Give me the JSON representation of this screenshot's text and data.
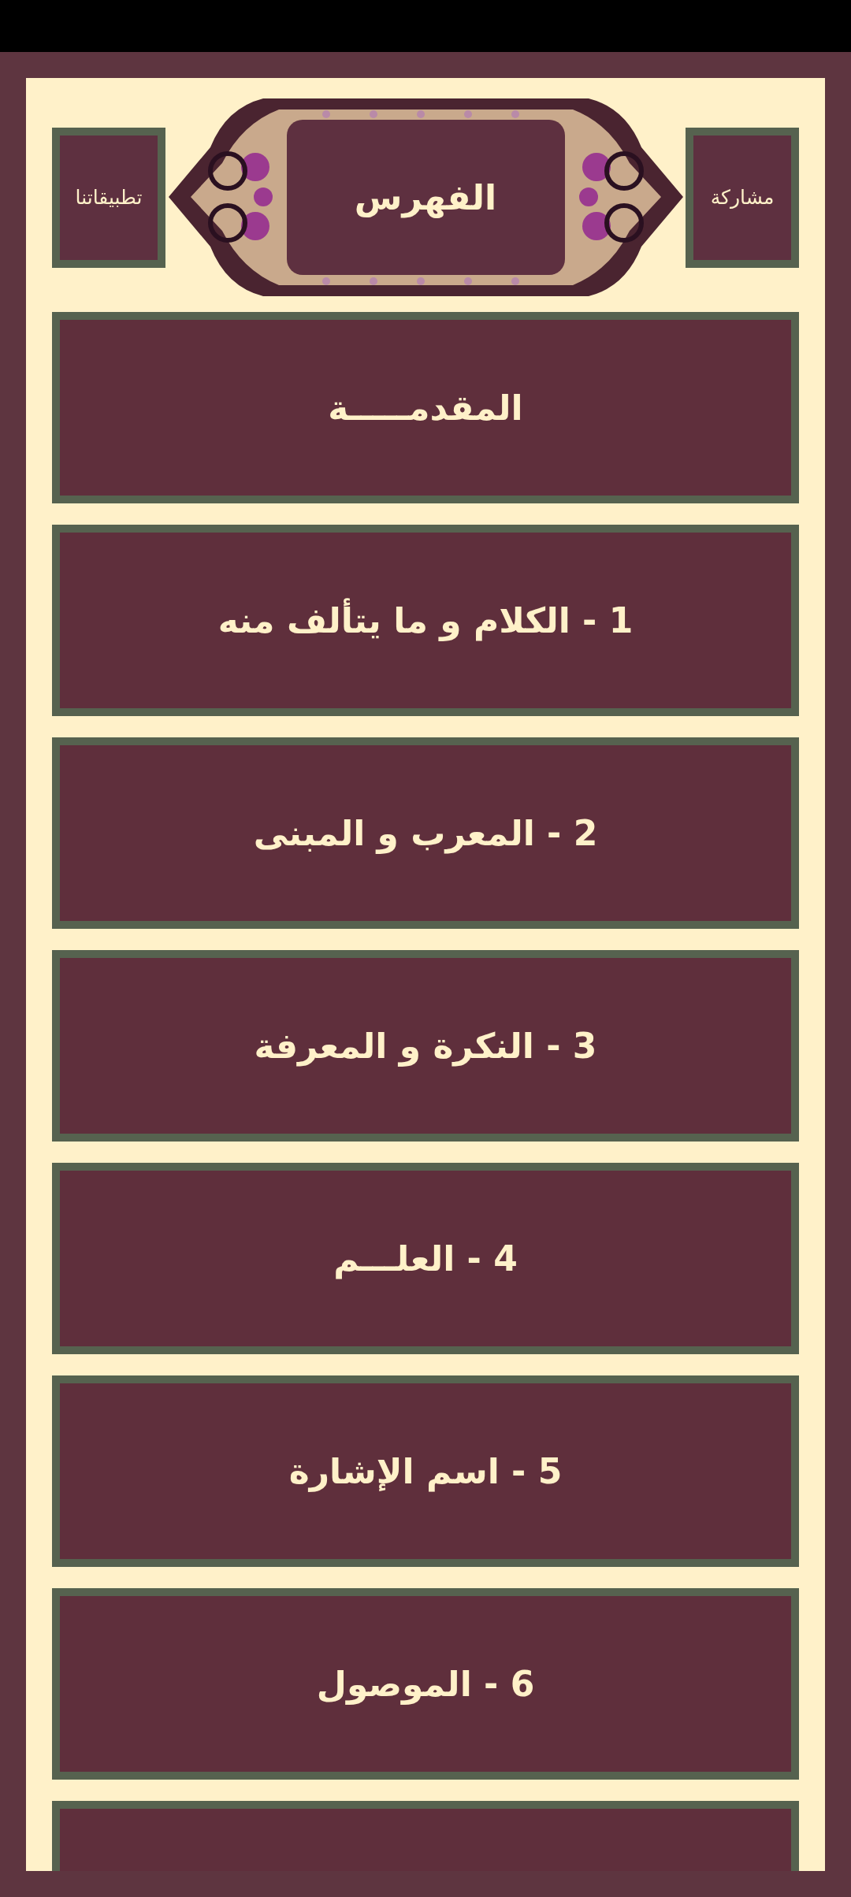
{
  "header": {
    "right_button": "مشاركة",
    "title": "الفهرس",
    "left_button": "تطبيقاتنا"
  },
  "chapters": [
    {
      "label": "المقدمـــــة"
    },
    {
      "label": "1 - الكلام و ما يتألف منه"
    },
    {
      "label": "2 - المعرب و المبنى"
    },
    {
      "label": "3 - النكرة و المعرفة"
    },
    {
      "label": "4 - العلـــم"
    },
    {
      "label": "5 - اسم الإشارة"
    },
    {
      "label": "6 - الموصول"
    }
  ]
}
